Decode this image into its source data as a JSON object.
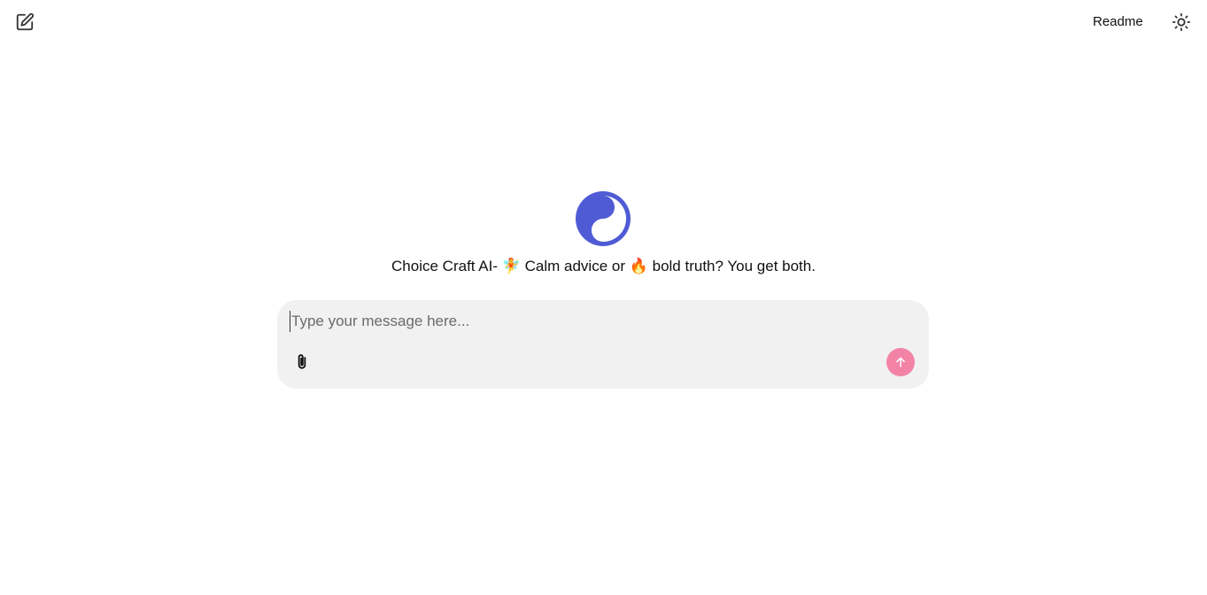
{
  "header": {
    "new_chat_icon": "edit-square-icon",
    "readme_label": "Readme",
    "theme_icon": "sun-icon"
  },
  "hero": {
    "logo_icon": "yin-yang-icon",
    "logo_color": "#4f5bd5",
    "tagline": "Choice Craft AI- 🧚 Calm advice or 🔥 bold truth? You get both."
  },
  "composer": {
    "placeholder": "Type your message here...",
    "value": "",
    "attach_icon": "paperclip-icon",
    "send_icon": "arrow-up-icon",
    "send_color": "#f283a7"
  }
}
